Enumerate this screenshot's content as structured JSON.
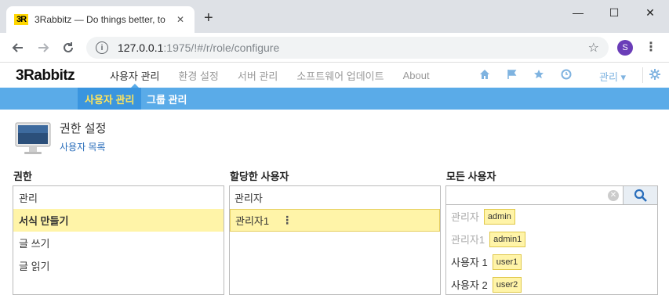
{
  "browser": {
    "favicon_text": "3R",
    "tab_title": "3Rabbitz — Do things better, to",
    "tab_close": "✕",
    "new_tab": "+",
    "minimize": "—",
    "maximize": "☐",
    "close": "✕",
    "url_host": "127.0.0.1",
    "url_rest": ":1975/!#/r/role/configure",
    "info_icon": "i",
    "bookmark_icon": "☆",
    "profile_initial": "S",
    "menu_icon": "⋮"
  },
  "app": {
    "logo": "3Rabbitz",
    "main_nav": [
      {
        "label": "사용자 관리",
        "active": true
      },
      {
        "label": "환경 설정",
        "active": false
      },
      {
        "label": "서버 관리",
        "active": false
      },
      {
        "label": "소프트웨어 업데이트",
        "active": false
      },
      {
        "label": "About",
        "active": false
      }
    ],
    "admin_menu_label": "관리 ▾",
    "header_icons": [
      "home-icon",
      "flag-icon",
      "star-icon",
      "clock-icon",
      "gear-icon"
    ],
    "accent_color": "#5aabe8",
    "sub_nav": [
      {
        "label": "사용자 관리",
        "active": true
      },
      {
        "label": "그룹 관리",
        "active": false
      }
    ]
  },
  "page": {
    "title": "권한 설정",
    "subtitle_link": "사용자 목록"
  },
  "roles": {
    "header": "권한",
    "items": [
      {
        "label": "관리",
        "selected": false
      },
      {
        "label": "서식 만들기",
        "selected": true
      },
      {
        "label": "글 쓰기",
        "selected": false
      },
      {
        "label": "글 읽기",
        "selected": false
      }
    ]
  },
  "assigned": {
    "header": "할당한 사용자",
    "items": [
      {
        "label": "관리자",
        "selected": false
      },
      {
        "label": "관리자1",
        "selected": true
      }
    ],
    "kebab": "⋮"
  },
  "all_users": {
    "header": "모든 사용자",
    "search_value": "",
    "items": [
      {
        "name": "관리자",
        "id": "admin",
        "dim": true
      },
      {
        "name": "관리자1",
        "id": "admin1",
        "dim": true
      },
      {
        "name": "사용자 1",
        "id": "user1",
        "dim": false
      },
      {
        "name": "사용자 2",
        "id": "user2",
        "dim": false
      }
    ]
  }
}
